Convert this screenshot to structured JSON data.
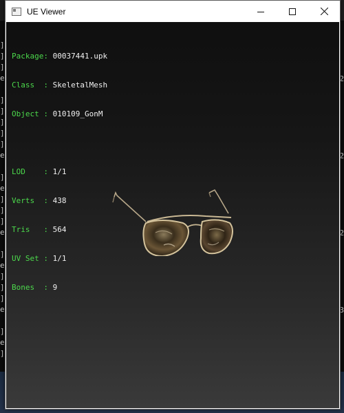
{
  "window": {
    "title": "UE Viewer"
  },
  "controls": {
    "minimize_icon": "minimize-icon",
    "maximize_icon": "maximize-icon",
    "close_icon": "close-icon"
  },
  "info": {
    "package_label": "Package:",
    "package_value": "00037441.upk",
    "class_label": "Class  :",
    "class_value": "SkeletalMesh",
    "object_label": "Object :",
    "object_value": "010109_GonM",
    "lod_label": "LOD    :",
    "lod_value": "1/1",
    "verts_label": "Verts  :",
    "verts_value": "438",
    "tris_label": "Tris   :",
    "tris_value": "564",
    "uvset_label": "UV Set :",
    "uvset_value": "1/1",
    "bones_label": "Bones  :",
    "bones_value": "9"
  },
  "model": {
    "name": "sunglasses-mesh"
  },
  "colors": {
    "label": "#4cd94c",
    "value": "#f0f0f0",
    "viewport_top": "#0f0f0f",
    "viewport_bottom": "#3a3a3a"
  }
}
